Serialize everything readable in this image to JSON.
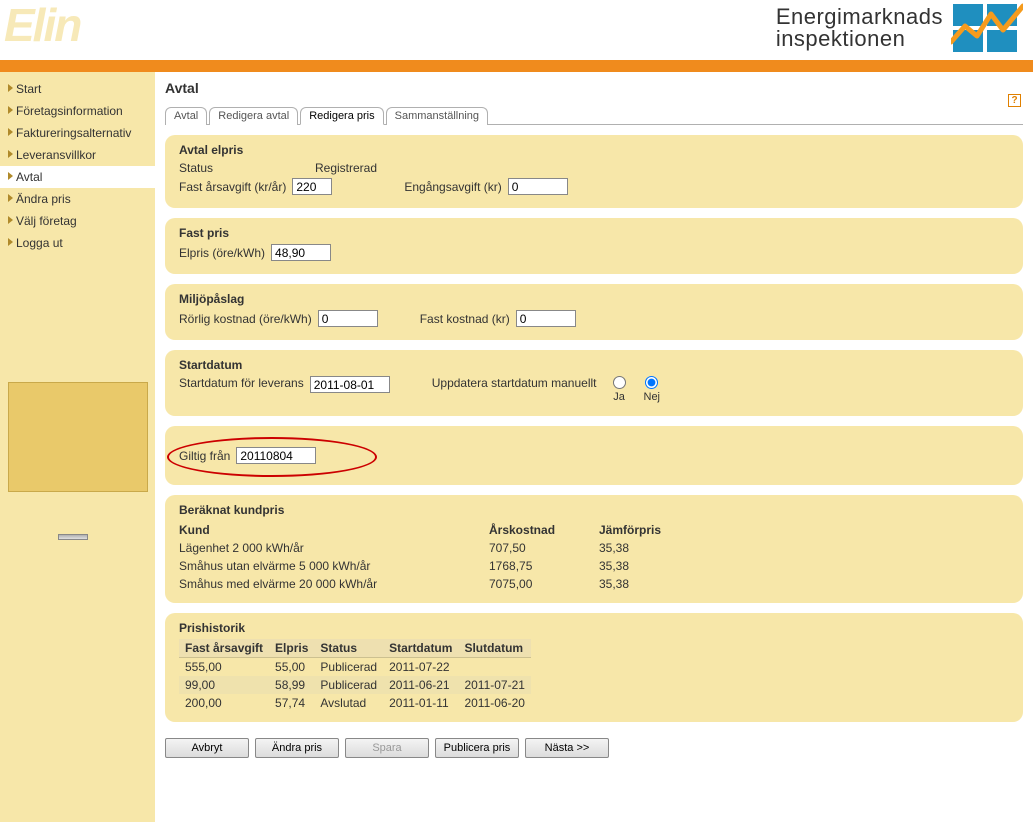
{
  "brand": {
    "app_logo": "Elin",
    "org_line1": "Energimarknads",
    "org_line2": "inspektionen"
  },
  "sidebar": {
    "items": [
      {
        "label": "Start",
        "active": false
      },
      {
        "label": "Företagsinformation",
        "active": false
      },
      {
        "label": "Faktureringsalternativ",
        "active": false
      },
      {
        "label": "Leveransvillkor",
        "active": false
      },
      {
        "label": "Avtal",
        "active": true
      },
      {
        "label": "Ändra pris",
        "active": false
      },
      {
        "label": "Välj företag",
        "active": false
      },
      {
        "label": "Logga ut",
        "active": false
      }
    ]
  },
  "page": {
    "title": "Avtal",
    "help_symbol": "?"
  },
  "tabs": [
    {
      "label": "Avtal",
      "active": false
    },
    {
      "label": "Redigera avtal",
      "active": false
    },
    {
      "label": "Redigera pris",
      "active": true
    },
    {
      "label": "Sammanställning",
      "active": false
    }
  ],
  "sections": {
    "avtal_elpris": {
      "title": "Avtal elpris",
      "status_label": "Status",
      "status_value": "Registrerad",
      "fast_ars_label": "Fast årsavgift (kr/år)",
      "fast_ars_value": "220",
      "engang_label": "Engångsavgift (kr)",
      "engang_value": "0"
    },
    "fast_pris": {
      "title": "Fast pris",
      "elpris_label": "Elpris (öre/kWh)",
      "elpris_value": "48,90"
    },
    "miljo": {
      "title": "Miljöpåslag",
      "rorlig_label": "Rörlig kostnad (öre/kWh)",
      "rorlig_value": "0",
      "fast_label": "Fast kostnad (kr)",
      "fast_value": "0"
    },
    "startdatum": {
      "title": "Startdatum",
      "leverans_label": "Startdatum för leverans",
      "leverans_value": "2011-08-01",
      "uppd_label": "Uppdatera startdatum manuellt",
      "ja": "Ja",
      "nej": "Nej",
      "selected": "nej"
    },
    "giltig": {
      "label": "Giltig från",
      "value": "20110804"
    },
    "kundpris": {
      "title": "Beräknat kundpris",
      "cols": {
        "kund": "Kund",
        "arskostnad": "Årskostnad",
        "jamforpris": "Jämförpris"
      },
      "rows": [
        {
          "kund": "Lägenhet 2 000 kWh/år",
          "ars": "707,50",
          "jam": "35,38"
        },
        {
          "kund": "Småhus utan elvärme 5 000 kWh/år",
          "ars": "1768,75",
          "jam": "35,38"
        },
        {
          "kund": "Småhus med elvärme 20 000 kWh/år",
          "ars": "7075,00",
          "jam": "35,38"
        }
      ]
    },
    "historik": {
      "title": "Prishistorik",
      "cols": {
        "fast": "Fast årsavgift",
        "elpris": "Elpris",
        "status": "Status",
        "start": "Startdatum",
        "slut": "Slutdatum"
      },
      "rows": [
        {
          "fast": "555,00",
          "elpris": "55,00",
          "status": "Publicerad",
          "start": "2011-07-22",
          "slut": ""
        },
        {
          "fast": "99,00",
          "elpris": "58,99",
          "status": "Publicerad",
          "start": "2011-06-21",
          "slut": "2011-07-21"
        },
        {
          "fast": "200,00",
          "elpris": "57,74",
          "status": "Avslutad",
          "start": "2011-01-11",
          "slut": "2011-06-20"
        }
      ]
    }
  },
  "buttons": {
    "avbryt": "Avbryt",
    "andra": "Ändra pris",
    "spara": "Spara",
    "publicera": "Publicera pris",
    "nasta": "Nästa >>"
  }
}
